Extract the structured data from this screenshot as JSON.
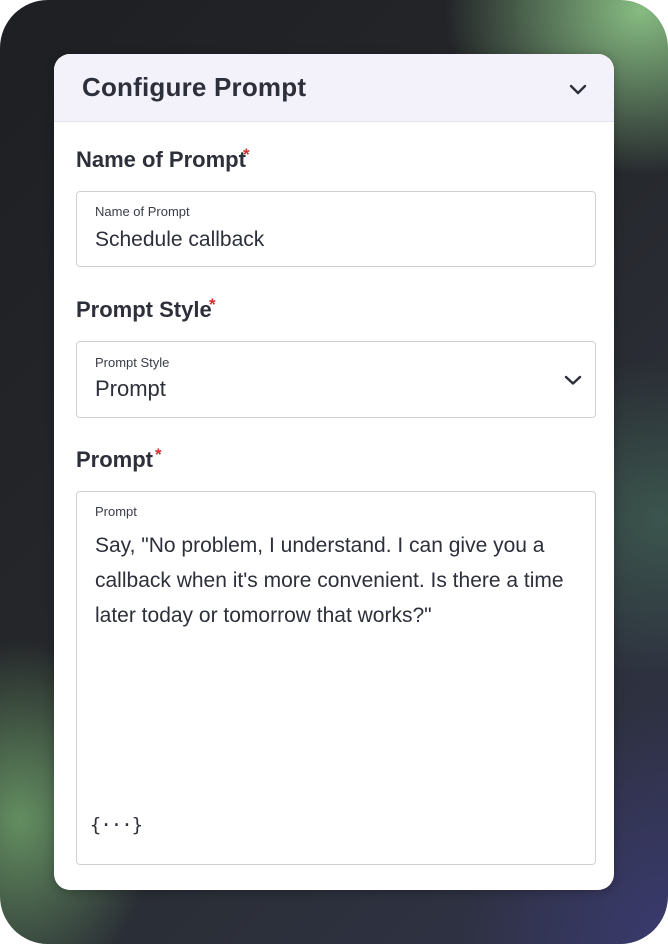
{
  "panel": {
    "title": "Configure Prompt",
    "collapse_icon": "chevron-down-icon"
  },
  "fields": {
    "name": {
      "label": "Name of Prompt",
      "required_mark": "*",
      "floating_label": "Name of Prompt",
      "value": "Schedule callback"
    },
    "style": {
      "label": "Prompt Style",
      "required_mark": "*",
      "floating_label": "Prompt Style",
      "selected": "Prompt",
      "dropdown_icon": "chevron-down-icon"
    },
    "prompt": {
      "label": "Prompt",
      "required_mark": "*",
      "floating_label": "Prompt",
      "value": "Say, \"No problem, I understand. I can give you a callback when it's more convenient. Is there a time later today or tomorrow that works?\"",
      "variable_icon": "curly-braces-variable-icon",
      "variable_glyph": "{···}"
    }
  },
  "colors": {
    "header_bg": "#f3f2fb",
    "required": "#d32f2f",
    "text": "#2d2f3a",
    "border": "#cfd0d6"
  }
}
